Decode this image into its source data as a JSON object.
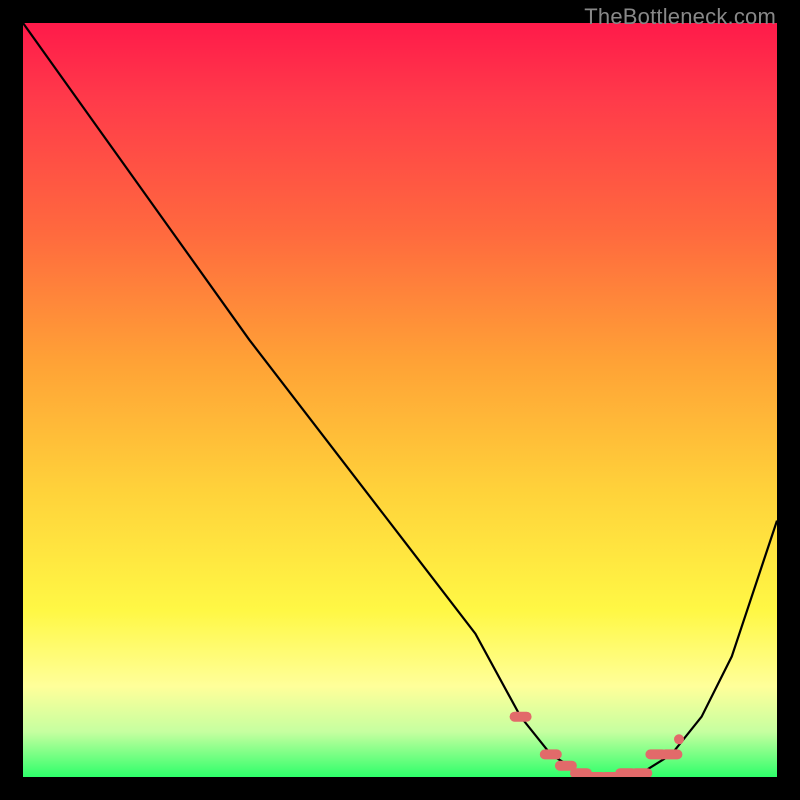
{
  "watermark": "TheBottleneck.com",
  "colors": {
    "frame_bg": "#000000",
    "gradient_top": "#ff1a4a",
    "gradient_mid": "#ffd23a",
    "gradient_bottom": "#2eff6a",
    "curve": "#000000",
    "marker": "#e26a6a"
  },
  "chart_data": {
    "type": "line",
    "title": "",
    "xlabel": "",
    "ylabel": "",
    "xlim": [
      0,
      100
    ],
    "ylim": [
      0,
      100
    ],
    "grid": false,
    "series": [
      {
        "name": "bottleneck-curve",
        "x": [
          0,
          10,
          20,
          30,
          40,
          50,
          60,
          66,
          70,
          74,
          78,
          82,
          86,
          90,
          94,
          100
        ],
        "y": [
          100,
          86,
          72,
          58,
          45,
          32,
          19,
          8,
          3,
          0.5,
          0,
          0.5,
          3,
          8,
          16,
          34
        ]
      }
    ],
    "markers": {
      "name": "optimal-zone",
      "x": [
        66,
        70,
        72,
        74,
        76,
        78,
        80,
        82,
        84,
        86
      ],
      "y": [
        8,
        3,
        1.5,
        0.5,
        0,
        0,
        0.5,
        0.5,
        3,
        3
      ]
    }
  }
}
